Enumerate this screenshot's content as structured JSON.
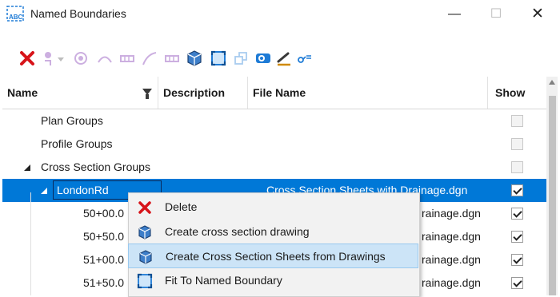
{
  "window": {
    "title": "Named Boundaries",
    "minimize": "—",
    "maximize": "☐",
    "close": "✕"
  },
  "toolbar": {
    "buttons": [
      {
        "name": "delete-icon",
        "enabled": true
      },
      {
        "name": "select-icon",
        "enabled": false
      },
      {
        "name": "select-dropdown-icon",
        "enabled": false
      },
      {
        "name": "group-icon",
        "enabled": false
      },
      {
        "name": "boundary-icon",
        "enabled": false
      },
      {
        "name": "grid-icon",
        "enabled": false
      },
      {
        "name": "curve-icon",
        "enabled": false
      },
      {
        "name": "grid2-icon",
        "enabled": false
      },
      {
        "name": "cube-icon",
        "enabled": true
      },
      {
        "name": "fit-icon",
        "enabled": true
      },
      {
        "name": "plan-icon",
        "enabled": false
      },
      {
        "name": "globe-icon",
        "enabled": true
      },
      {
        "name": "pen-icon",
        "enabled": true
      },
      {
        "name": "settings-icon",
        "enabled": true
      }
    ]
  },
  "grid": {
    "columns": [
      "Name",
      "Description",
      "File Name",
      "Show"
    ],
    "rows": [
      {
        "name": "Plan Groups",
        "file": "",
        "show": false,
        "level": 0,
        "expander": ""
      },
      {
        "name": "Profile Groups",
        "file": "",
        "show": false,
        "level": 0,
        "expander": ""
      },
      {
        "name": "Cross Section Groups",
        "file": "",
        "show": false,
        "level": 0,
        "expander": "expanded"
      },
      {
        "name": "LondonRd",
        "file": "Cross Section Sheets with Drainage.dgn",
        "show": true,
        "level": 1,
        "expander": "expanded",
        "selected": true
      },
      {
        "name": "50+00.0",
        "file": "rainage.dgn",
        "show": true,
        "level": 2,
        "expander": ""
      },
      {
        "name": "50+50.0",
        "file": "rainage.dgn",
        "show": true,
        "level": 2,
        "expander": ""
      },
      {
        "name": "51+00.0",
        "file": "rainage.dgn",
        "show": true,
        "level": 2,
        "expander": ""
      },
      {
        "name": "51+50.0",
        "file": "rainage.dgn",
        "show": true,
        "level": 2,
        "expander": ""
      }
    ]
  },
  "context_menu": {
    "items": [
      {
        "label": "Delete",
        "icon": "delete-icon",
        "hover": false
      },
      {
        "label": "Create cross section drawing",
        "icon": "cube-icon",
        "hover": false
      },
      {
        "label": "Create Cross Section Sheets from Drawings",
        "icon": "cube-icon",
        "hover": true
      },
      {
        "label": "Fit To Named Boundary",
        "icon": "fit-icon",
        "hover": false
      }
    ]
  }
}
